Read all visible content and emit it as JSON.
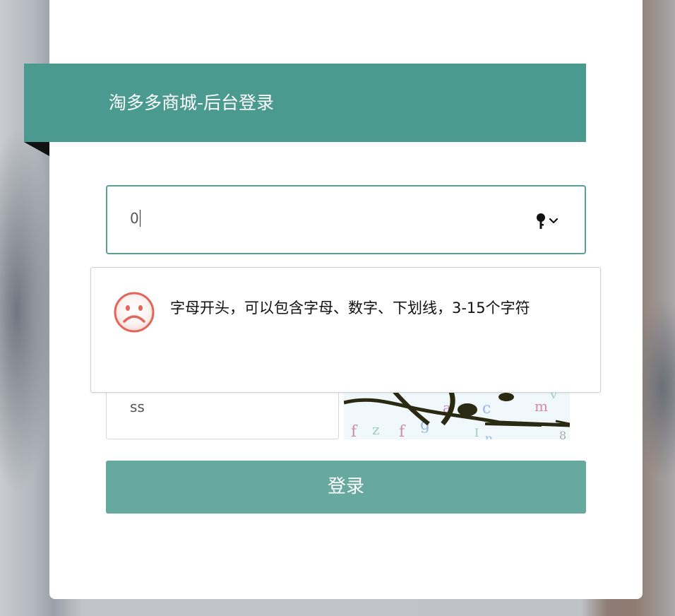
{
  "header": {
    "title": "淘多多商城-后台登录"
  },
  "form": {
    "username_value": "0",
    "captcha_value": "ss",
    "submit_label": "登录"
  },
  "validation_tooltip": {
    "message": "字母开头，可以包含字母、数字、下划线，3-15个字符"
  },
  "icons": {
    "password_manager": "key-icon",
    "dropdown": "chevron-down-icon",
    "error": "sad-face-icon"
  },
  "colors": {
    "accent": "#4a9a8f",
    "button": "#67a99f",
    "error_icon": "#e0655a"
  }
}
